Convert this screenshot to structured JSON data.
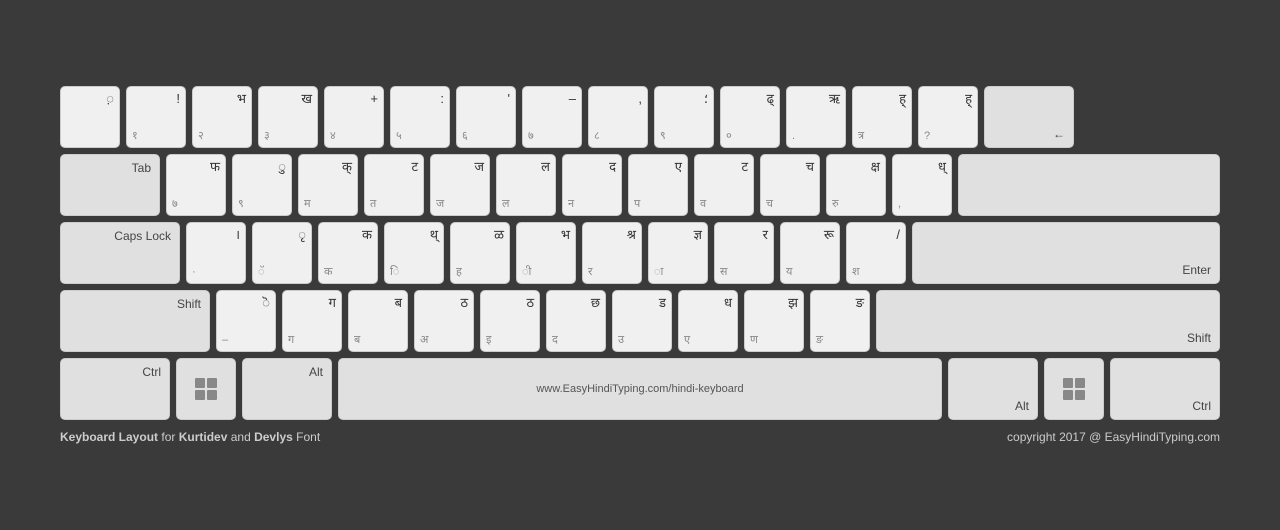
{
  "keyboard": {
    "rows": [
      {
        "keys": [
          {
            "type": "char",
            "top": "",
            "bottom": "",
            "main": "़",
            "label": ""
          },
          {
            "type": "char",
            "top": "!",
            "bottom": "१",
            "main": ""
          },
          {
            "type": "char",
            "top": "भ",
            "bottom": "२",
            "main": ""
          },
          {
            "type": "char",
            "top": "ख",
            "bottom": "३",
            "main": ""
          },
          {
            "type": "char",
            "top": "+",
            "bottom": "४",
            "main": ""
          },
          {
            "type": "char",
            "top": ":",
            "bottom": "५",
            "main": ""
          },
          {
            "type": "char",
            "top": "'",
            "bottom": "६",
            "main": ""
          },
          {
            "type": "char",
            "top": "–",
            "bottom": "७",
            "main": ""
          },
          {
            "type": "char",
            "top": ",",
            "bottom": "८",
            "main": ""
          },
          {
            "type": "char",
            "top": "؛",
            "bottom": "९",
            "main": ""
          },
          {
            "type": "char",
            "top": "ढ्",
            "bottom": "०",
            "main": ""
          },
          {
            "type": "char",
            "top": "ऋ",
            "bottom": ".",
            "main": ""
          },
          {
            "type": "char",
            "top": "ह्",
            "bottom": "त्र",
            "main": ""
          },
          {
            "type": "char",
            "top": "ह्",
            "bottom": "?",
            "main": ""
          },
          {
            "type": "special",
            "label": "←",
            "width": "backspace"
          }
        ]
      },
      {
        "keys": [
          {
            "type": "special",
            "label": "Tab",
            "width": "tab"
          },
          {
            "type": "char",
            "top": "फ",
            "bottom": "७",
            "main": ""
          },
          {
            "type": "char",
            "top": "ु",
            "bottom": "९",
            "main": ""
          },
          {
            "type": "char",
            "top": "क्",
            "bottom": "म",
            "main": ""
          },
          {
            "type": "char",
            "top": "ट",
            "bottom": "त",
            "main": ""
          },
          {
            "type": "char",
            "top": "ज",
            "bottom": "ज",
            "main": ""
          },
          {
            "type": "char",
            "top": "ल",
            "bottom": "ल",
            "main": ""
          },
          {
            "type": "char",
            "top": "द",
            "bottom": "न",
            "main": ""
          },
          {
            "type": "char",
            "top": "ए",
            "bottom": "प",
            "main": ""
          },
          {
            "type": "char",
            "top": "ट",
            "bottom": "व",
            "main": ""
          },
          {
            "type": "char",
            "top": "च",
            "bottom": "च",
            "main": ""
          },
          {
            "type": "char",
            "top": "क्ष",
            "bottom": "रु",
            "main": ""
          },
          {
            "type": "char",
            "top": "ध्",
            "bottom": ",",
            "main": ""
          },
          {
            "type": "special",
            "label": "",
            "width": "enter",
            "rowspan": true
          }
        ]
      },
      {
        "keys": [
          {
            "type": "special",
            "label": "Caps Lock",
            "width": "caps"
          },
          {
            "type": "char",
            "top": "।",
            "bottom": "·",
            "main": ""
          },
          {
            "type": "char",
            "top": "ृ",
            "bottom": "ॅ",
            "main": ""
          },
          {
            "type": "char",
            "top": "क",
            "bottom": "क",
            "main": ""
          },
          {
            "type": "char",
            "top": "थ्",
            "bottom": "ि",
            "main": ""
          },
          {
            "type": "char",
            "top": "ळ",
            "bottom": "ह",
            "main": ""
          },
          {
            "type": "char",
            "top": "भ",
            "bottom": "ी",
            "main": ""
          },
          {
            "type": "char",
            "top": "श्र",
            "bottom": "र",
            "main": ""
          },
          {
            "type": "char",
            "top": "ज्ञ",
            "bottom": "ा",
            "main": ""
          },
          {
            "type": "char",
            "top": "र",
            "bottom": "स",
            "main": ""
          },
          {
            "type": "char",
            "top": "रू",
            "bottom": "य",
            "main": ""
          },
          {
            "type": "char",
            "top": "/",
            "bottom": "श",
            "main": ""
          },
          {
            "type": "special",
            "label": "Enter",
            "width": "enter"
          }
        ]
      },
      {
        "keys": [
          {
            "type": "special",
            "label": "Shift",
            "width": "shift-l"
          },
          {
            "type": "char",
            "top": "ॆ",
            "bottom": "–",
            "main": ""
          },
          {
            "type": "char",
            "top": "ग",
            "bottom": "ग",
            "main": ""
          },
          {
            "type": "char",
            "top": "ब",
            "bottom": "ब",
            "main": ""
          },
          {
            "type": "char",
            "top": "ठ",
            "bottom": "अ",
            "main": ""
          },
          {
            "type": "char",
            "top": "ठ",
            "bottom": "इ",
            "main": ""
          },
          {
            "type": "char",
            "top": "छ",
            "bottom": "द",
            "main": ""
          },
          {
            "type": "char",
            "top": "ड",
            "bottom": "उ",
            "main": ""
          },
          {
            "type": "char",
            "top": "ध",
            "bottom": "ए",
            "main": ""
          },
          {
            "type": "char",
            "top": "झ",
            "bottom": "ण",
            "main": ""
          },
          {
            "type": "char",
            "top": "ङ",
            "bottom": "ङ",
            "main": ""
          },
          {
            "type": "special",
            "label": "Shift",
            "width": "shift-r"
          }
        ]
      },
      {
        "keys": [
          {
            "type": "special",
            "label": "Ctrl",
            "width": "ctrl"
          },
          {
            "type": "special",
            "label": "win",
            "width": "win"
          },
          {
            "type": "special",
            "label": "Alt",
            "width": "alt"
          },
          {
            "type": "special",
            "label": "www.EasyHindiTyping.com/hindi-keyboard",
            "width": "space"
          },
          {
            "type": "special",
            "label": "Alt",
            "width": "alt"
          },
          {
            "type": "special",
            "label": "win",
            "width": "win"
          },
          {
            "type": "special",
            "label": "Ctrl",
            "width": "ctrl"
          }
        ]
      }
    ],
    "footer": {
      "left": "Keyboard Layout for Kurtidev and Devlys Font",
      "right": "copyright 2017 @ EasyHindiTyping.com"
    }
  }
}
